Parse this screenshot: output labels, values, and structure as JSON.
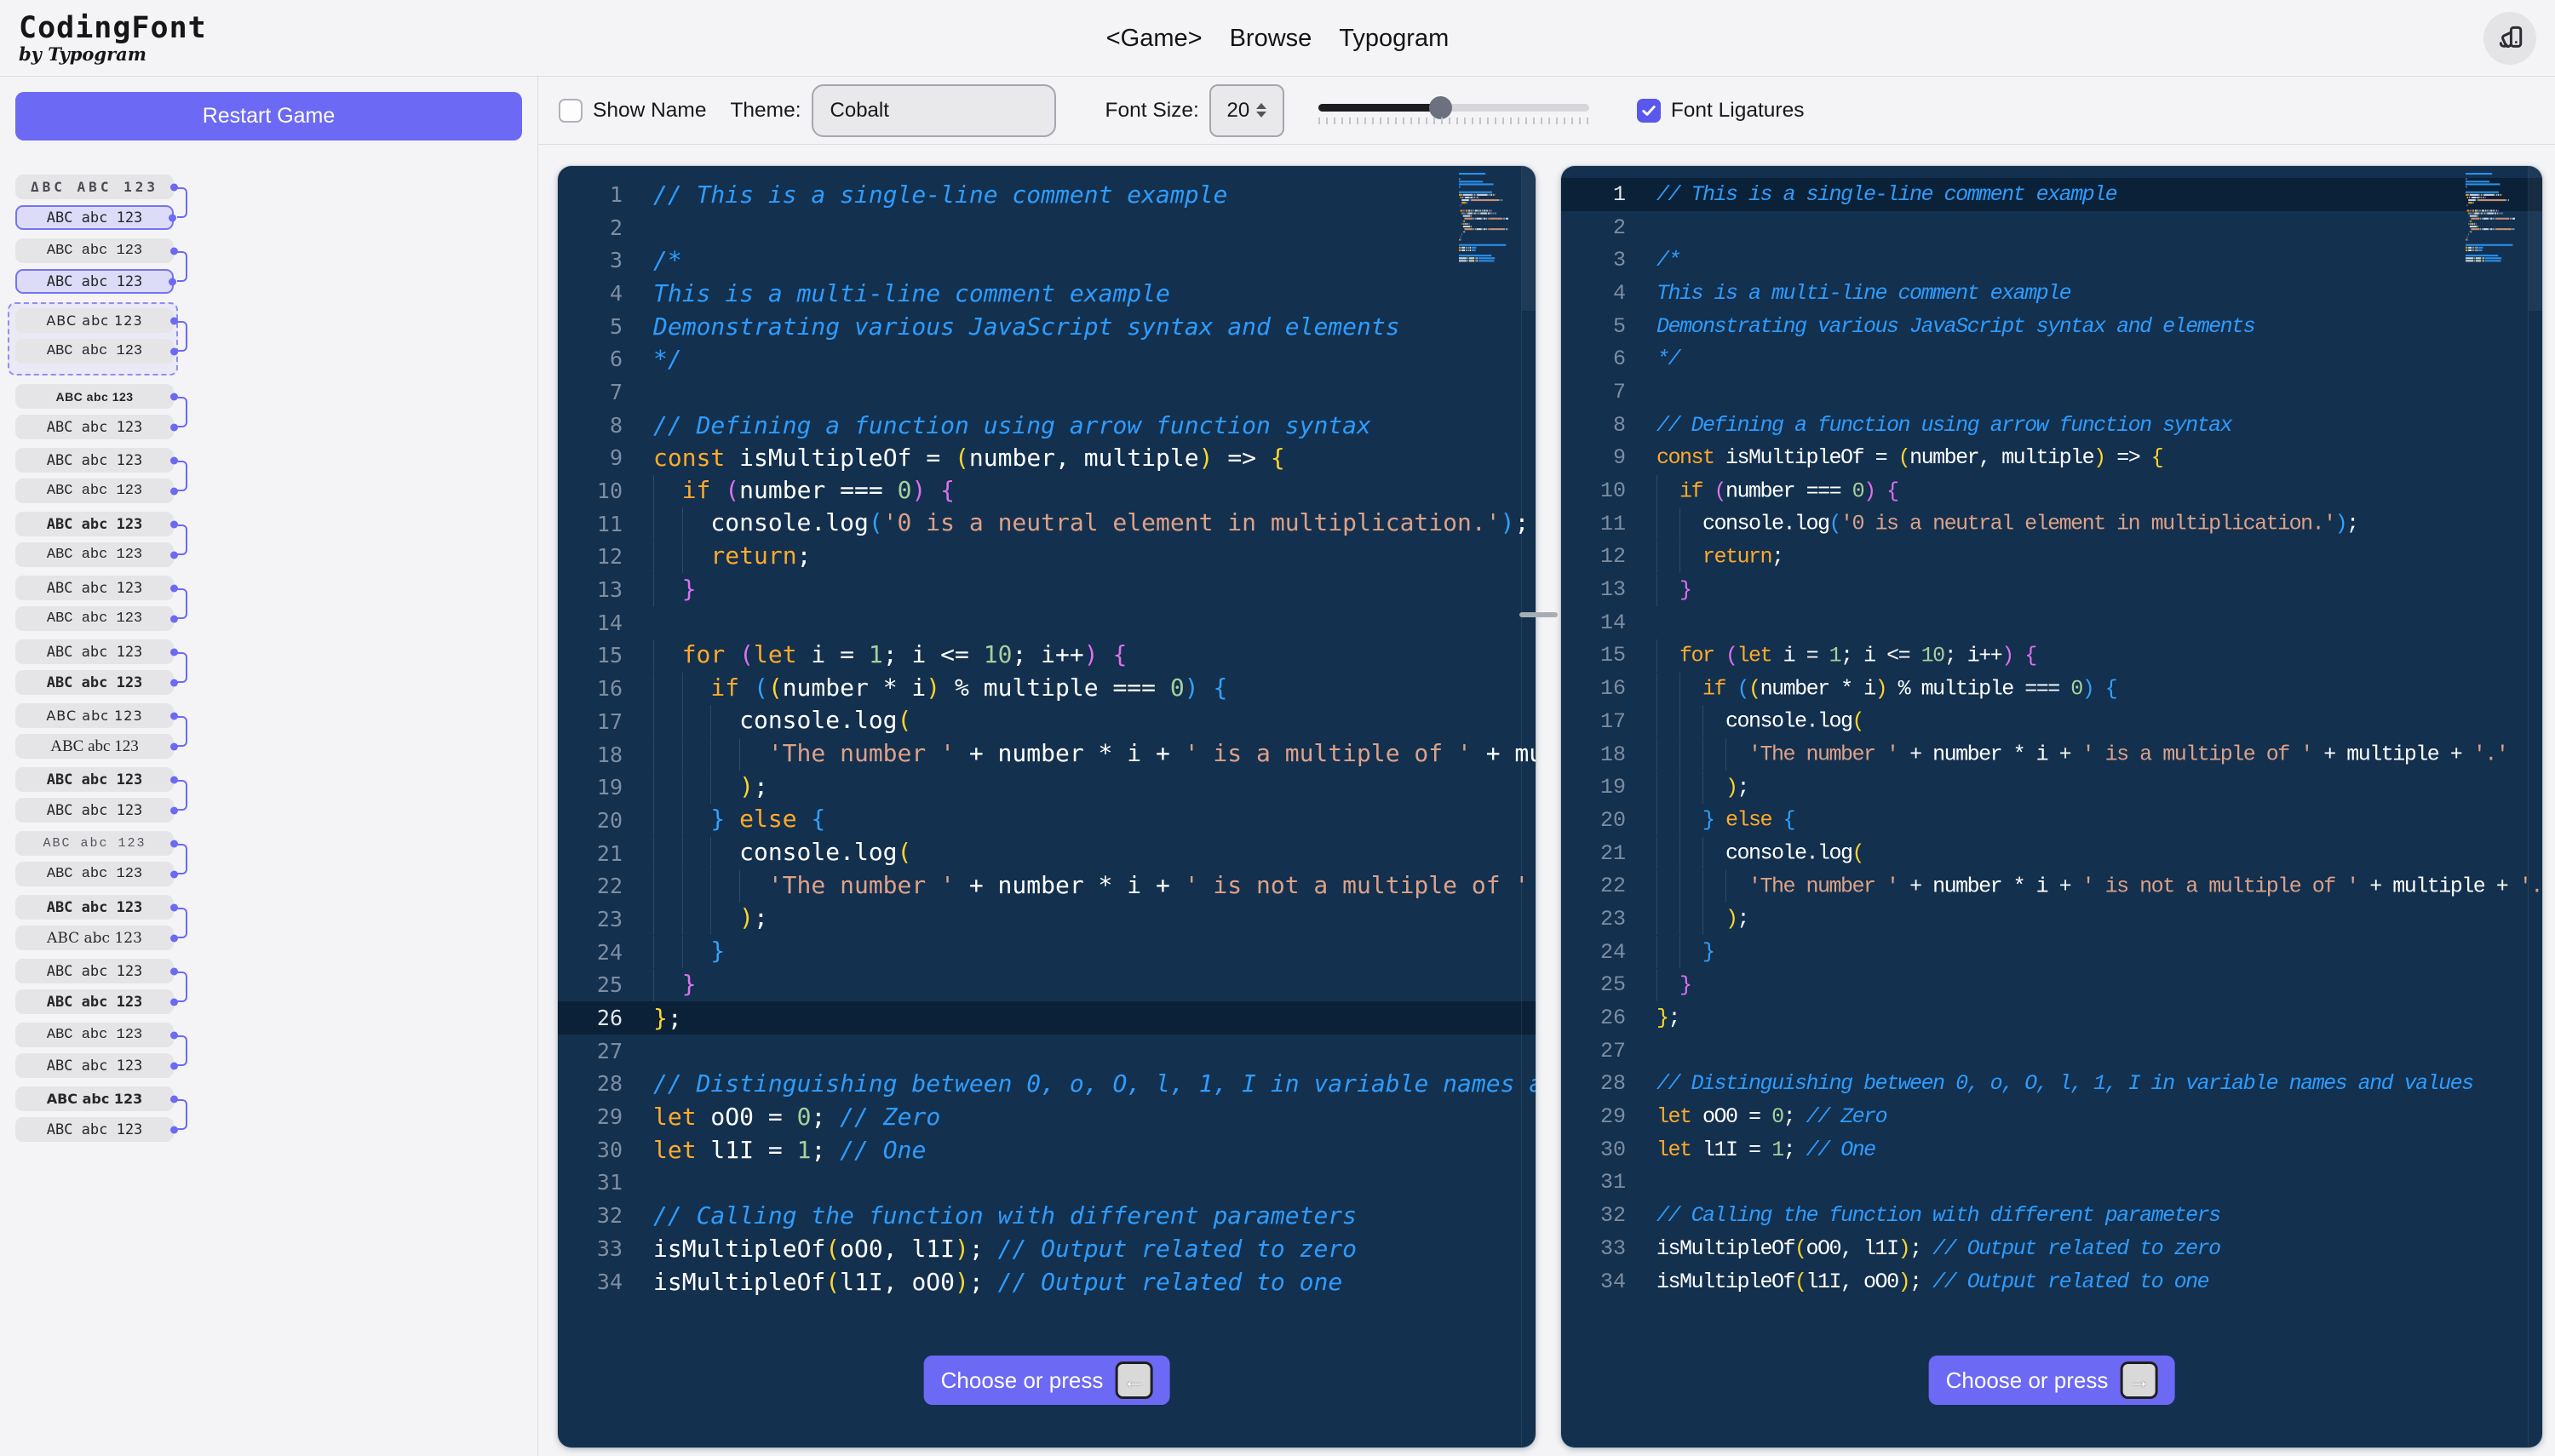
{
  "header": {
    "logo_title": "CodingFont",
    "logo_subtitle": "by Typogram",
    "nav": [
      {
        "label": "<Game>"
      },
      {
        "label": "Browse"
      },
      {
        "label": "Typogram"
      }
    ]
  },
  "sidebar": {
    "restart_label": "Restart Game",
    "pairs": [
      {
        "current": false,
        "chips": [
          {
            "text": "ΔBC ABC 123",
            "font": "f-display",
            "winner": false
          },
          {
            "text": "ABC abc 123",
            "font": "f-mono",
            "winner": true
          }
        ]
      },
      {
        "current": false,
        "chips": [
          {
            "text": "ABC abc 123",
            "font": "f-lib",
            "winner": false
          },
          {
            "text": "ABC abc 123",
            "font": "f-mono",
            "winner": true
          }
        ]
      },
      {
        "current": true,
        "chips": [
          {
            "text": "ABC abc 123",
            "font": "f-sans",
            "winner": false
          },
          {
            "text": "ABC abc 123",
            "font": "f-lib",
            "winner": false
          }
        ]
      },
      {
        "current": false,
        "chips": [
          {
            "text": "ABC abc 123",
            "font": "f-small",
            "winner": false
          },
          {
            "text": "ABC abc 123",
            "font": "f-mono",
            "winner": false
          }
        ]
      },
      {
        "current": false,
        "chips": [
          {
            "text": "ABC abc 123",
            "font": "f-mono",
            "winner": false
          },
          {
            "text": "ABC abc 123",
            "font": "f-lib",
            "winner": false
          }
        ]
      },
      {
        "current": false,
        "chips": [
          {
            "text": "ABC abc 123",
            "font": "f-mono-b",
            "winner": false
          },
          {
            "text": "ABC abc 123",
            "font": "f-lib",
            "winner": false
          }
        ]
      },
      {
        "current": false,
        "chips": [
          {
            "text": "ABC abc 123",
            "font": "f-mono",
            "winner": false
          },
          {
            "text": "ABC abc 123",
            "font": "f-lib",
            "winner": false
          }
        ]
      },
      {
        "current": false,
        "chips": [
          {
            "text": "ABC abc 123",
            "font": "f-mono",
            "winner": false
          },
          {
            "text": "ABC abc 123",
            "font": "f-mono-b",
            "winner": false
          }
        ]
      },
      {
        "current": false,
        "chips": [
          {
            "text": "ABC abc 123",
            "font": "f-sans",
            "winner": false
          },
          {
            "text": "ABC abc 123",
            "font": "f-lserif",
            "winner": false
          }
        ]
      },
      {
        "current": false,
        "chips": [
          {
            "text": "ABC abc 123",
            "font": "f-mono-b",
            "winner": false
          },
          {
            "text": "ABC abc 123",
            "font": "f-mono",
            "winner": false
          }
        ]
      },
      {
        "current": false,
        "chips": [
          {
            "text": "ABC abc 123",
            "font": "f-light",
            "winner": false
          },
          {
            "text": "ABC abc 123",
            "font": "f-lib",
            "winner": false
          }
        ]
      },
      {
        "current": false,
        "chips": [
          {
            "text": "ABC abc 123",
            "font": "f-mono-b",
            "winner": false
          },
          {
            "text": "ABC abc 123",
            "font": "f-serif",
            "winner": false
          }
        ]
      },
      {
        "current": false,
        "chips": [
          {
            "text": "ABC abc 123",
            "font": "f-mono",
            "winner": false
          },
          {
            "text": "ABC abc 123",
            "font": "f-mono-b",
            "winner": false
          }
        ]
      },
      {
        "current": false,
        "chips": [
          {
            "text": "ABC abc 123",
            "font": "f-lib",
            "winner": false
          },
          {
            "text": "ABC abc 123",
            "font": "f-mono",
            "winner": false
          }
        ]
      },
      {
        "current": false,
        "chips": [
          {
            "text": "ABC abc 123",
            "font": "f-sans-b",
            "winner": false
          },
          {
            "text": "ABC abc 123",
            "font": "f-mono",
            "winner": false
          }
        ]
      }
    ]
  },
  "toolbar": {
    "show_name_label": "Show Name",
    "show_name_checked": false,
    "theme_label": "Theme:",
    "theme_value": "Cobalt",
    "font_size_label": "Font Size:",
    "font_size_value": "20",
    "slider_percent": 45,
    "font_ligatures_label": "Font Ligatures",
    "font_ligatures_checked": true
  },
  "editor": {
    "left": {
      "active_line": 26,
      "choose_label": "Choose or press",
      "key_label": "←"
    },
    "right": {
      "active_line": 1,
      "choose_label": "Choose or press",
      "key_label": "→"
    },
    "lines": [
      [
        {
          "c": "com",
          "t": "// This is a single-line comment example"
        }
      ],
      [],
      [
        {
          "c": "com",
          "t": "/*"
        }
      ],
      [
        {
          "c": "com",
          "t": "This is a multi-line comment example"
        }
      ],
      [
        {
          "c": "com",
          "t": "Demonstrating various JavaScript syntax and elements"
        }
      ],
      [
        {
          "c": "com",
          "t": "*/"
        }
      ],
      [],
      [
        {
          "c": "com",
          "t": "// Defining a function using arrow function syntax"
        }
      ],
      [
        {
          "c": "kw",
          "t": "const"
        },
        {
          "c": "pl",
          "t": " isMultipleOf "
        },
        {
          "c": "op",
          "t": "="
        },
        {
          "c": "pl",
          "t": " "
        },
        {
          "c": "pby",
          "t": "("
        },
        {
          "c": "pl",
          "t": "number, multiple"
        },
        {
          "c": "pby",
          "t": ")"
        },
        {
          "c": "pl",
          "t": " "
        },
        {
          "c": "op",
          "t": "=>"
        },
        {
          "c": "pl",
          "t": " "
        },
        {
          "c": "pby",
          "t": "{"
        }
      ],
      [
        {
          "c": "ind",
          "n": 1
        },
        {
          "c": "kw",
          "t": "if"
        },
        {
          "c": "pl",
          "t": " "
        },
        {
          "c": "pbp",
          "t": "("
        },
        {
          "c": "pl",
          "t": "number "
        },
        {
          "c": "op",
          "t": "==="
        },
        {
          "c": "pl",
          "t": " "
        },
        {
          "c": "num",
          "t": "0"
        },
        {
          "c": "pbp",
          "t": ")"
        },
        {
          "c": "pl",
          "t": " "
        },
        {
          "c": "pbp",
          "t": "{"
        }
      ],
      [
        {
          "c": "ind",
          "n": 2
        },
        {
          "c": "pl",
          "t": "console.log"
        },
        {
          "c": "pbb",
          "t": "("
        },
        {
          "c": "str",
          "t": "'0 is a neutral element in multiplication.'"
        },
        {
          "c": "pbb",
          "t": ")"
        },
        {
          "c": "pl",
          "t": ";"
        }
      ],
      [
        {
          "c": "ind",
          "n": 2
        },
        {
          "c": "kw",
          "t": "return"
        },
        {
          "c": "pl",
          "t": ";"
        }
      ],
      [
        {
          "c": "ind",
          "n": 1
        },
        {
          "c": "pbp",
          "t": "}"
        }
      ],
      [],
      [
        {
          "c": "ind",
          "n": 1
        },
        {
          "c": "kw",
          "t": "for"
        },
        {
          "c": "pl",
          "t": " "
        },
        {
          "c": "pbp",
          "t": "("
        },
        {
          "c": "kw",
          "t": "let"
        },
        {
          "c": "pl",
          "t": " i "
        },
        {
          "c": "op",
          "t": "="
        },
        {
          "c": "pl",
          "t": " "
        },
        {
          "c": "num",
          "t": "1"
        },
        {
          "c": "pl",
          "t": "; i "
        },
        {
          "c": "op",
          "t": "<="
        },
        {
          "c": "pl",
          "t": " "
        },
        {
          "c": "num",
          "t": "10"
        },
        {
          "c": "pl",
          "t": "; i"
        },
        {
          "c": "op",
          "t": "++"
        },
        {
          "c": "pbp",
          "t": ")"
        },
        {
          "c": "pl",
          "t": " "
        },
        {
          "c": "pbp",
          "t": "{"
        }
      ],
      [
        {
          "c": "ind",
          "n": 2
        },
        {
          "c": "kw",
          "t": "if"
        },
        {
          "c": "pl",
          "t": " "
        },
        {
          "c": "pbb",
          "t": "("
        },
        {
          "c": "pby",
          "t": "("
        },
        {
          "c": "pl",
          "t": "number "
        },
        {
          "c": "op",
          "t": "*"
        },
        {
          "c": "pl",
          "t": " i"
        },
        {
          "c": "pby",
          "t": ")"
        },
        {
          "c": "pl",
          "t": " "
        },
        {
          "c": "op",
          "t": "%"
        },
        {
          "c": "pl",
          "t": " multiple "
        },
        {
          "c": "op",
          "t": "==="
        },
        {
          "c": "pl",
          "t": " "
        },
        {
          "c": "num",
          "t": "0"
        },
        {
          "c": "pbb",
          "t": ")"
        },
        {
          "c": "pl",
          "t": " "
        },
        {
          "c": "pbb",
          "t": "{"
        }
      ],
      [
        {
          "c": "ind",
          "n": 3
        },
        {
          "c": "pl",
          "t": "console.log"
        },
        {
          "c": "pby",
          "t": "("
        }
      ],
      [
        {
          "c": "ind",
          "n": 4
        },
        {
          "c": "str",
          "t": "'The number '"
        },
        {
          "c": "pl",
          "t": " "
        },
        {
          "c": "op",
          "t": "+"
        },
        {
          "c": "pl",
          "t": " number "
        },
        {
          "c": "op",
          "t": "*"
        },
        {
          "c": "pl",
          "t": " i "
        },
        {
          "c": "op",
          "t": "+"
        },
        {
          "c": "pl",
          "t": " "
        },
        {
          "c": "str",
          "t": "' is a multiple of '"
        },
        {
          "c": "pl",
          "t": " "
        },
        {
          "c": "op",
          "t": "+"
        },
        {
          "c": "pl",
          "t": " multiple "
        },
        {
          "c": "op",
          "t": "+"
        },
        {
          "c": "pl",
          "t": " "
        },
        {
          "c": "str",
          "t": "'.'"
        }
      ],
      [
        {
          "c": "ind",
          "n": 3
        },
        {
          "c": "pby",
          "t": ")"
        },
        {
          "c": "pl",
          "t": ";"
        }
      ],
      [
        {
          "c": "ind",
          "n": 2
        },
        {
          "c": "pbb",
          "t": "}"
        },
        {
          "c": "pl",
          "t": " "
        },
        {
          "c": "kw",
          "t": "else"
        },
        {
          "c": "pl",
          "t": " "
        },
        {
          "c": "pbb",
          "t": "{"
        }
      ],
      [
        {
          "c": "ind",
          "n": 3
        },
        {
          "c": "pl",
          "t": "console.log"
        },
        {
          "c": "pby",
          "t": "("
        }
      ],
      [
        {
          "c": "ind",
          "n": 4
        },
        {
          "c": "str",
          "t": "'The number '"
        },
        {
          "c": "pl",
          "t": " "
        },
        {
          "c": "op",
          "t": "+"
        },
        {
          "c": "pl",
          "t": " number "
        },
        {
          "c": "op",
          "t": "*"
        },
        {
          "c": "pl",
          "t": " i "
        },
        {
          "c": "op",
          "t": "+"
        },
        {
          "c": "pl",
          "t": " "
        },
        {
          "c": "str",
          "t": "' is not a multiple of '"
        },
        {
          "c": "pl",
          "t": " "
        },
        {
          "c": "op",
          "t": "+"
        },
        {
          "c": "pl",
          "t": " multiple "
        },
        {
          "c": "op",
          "t": "+"
        },
        {
          "c": "pl",
          "t": " "
        },
        {
          "c": "str",
          "t": "'.'"
        }
      ],
      [
        {
          "c": "ind",
          "n": 3
        },
        {
          "c": "pby",
          "t": ")"
        },
        {
          "c": "pl",
          "t": ";"
        }
      ],
      [
        {
          "c": "ind",
          "n": 2
        },
        {
          "c": "pbb",
          "t": "}"
        }
      ],
      [
        {
          "c": "ind",
          "n": 1
        },
        {
          "c": "pbp",
          "t": "}"
        }
      ],
      [
        {
          "c": "pby",
          "t": "}"
        },
        {
          "c": "pl",
          "t": ";"
        }
      ],
      [],
      [
        {
          "c": "com",
          "t": "// Distinguishing between 0, o, O, l, 1, I in variable names and values"
        }
      ],
      [
        {
          "c": "kw",
          "t": "let"
        },
        {
          "c": "pl",
          "t": " oO0 "
        },
        {
          "c": "op",
          "t": "="
        },
        {
          "c": "pl",
          "t": " "
        },
        {
          "c": "num",
          "t": "0"
        },
        {
          "c": "pl",
          "t": "; "
        },
        {
          "c": "com",
          "t": "// Zero"
        }
      ],
      [
        {
          "c": "kw",
          "t": "let"
        },
        {
          "c": "pl",
          "t": " l1I "
        },
        {
          "c": "op",
          "t": "="
        },
        {
          "c": "pl",
          "t": " "
        },
        {
          "c": "num",
          "t": "1"
        },
        {
          "c": "pl",
          "t": "; "
        },
        {
          "c": "com",
          "t": "// One"
        }
      ],
      [],
      [
        {
          "c": "com",
          "t": "// Calling the function with different parameters"
        }
      ],
      [
        {
          "c": "pl",
          "t": "isMultipleOf"
        },
        {
          "c": "pby",
          "t": "("
        },
        {
          "c": "pl",
          "t": "oO0, l1I"
        },
        {
          "c": "pby",
          "t": ")"
        },
        {
          "c": "pl",
          "t": "; "
        },
        {
          "c": "com",
          "t": "// Output related to zero"
        }
      ],
      [
        {
          "c": "pl",
          "t": "isMultipleOf"
        },
        {
          "c": "pby",
          "t": "("
        },
        {
          "c": "pl",
          "t": "l1I, oO0"
        },
        {
          "c": "pby",
          "t": ")"
        },
        {
          "c": "pl",
          "t": "; "
        },
        {
          "c": "com",
          "t": "// Output related to one"
        }
      ]
    ]
  },
  "colors": {
    "accent": "#6C69F4",
    "editor_bg": "#13304E",
    "active_line_bg": "#0B2137",
    "comment": "#2E9CFF",
    "keyword": "#FFAA2B",
    "string": "#DDA188",
    "number": "#A9CF9B",
    "bracket_yellow": "#FFD52E",
    "bracket_magenta": "#DD70F0",
    "bracket_blue": "#31A1FF"
  }
}
